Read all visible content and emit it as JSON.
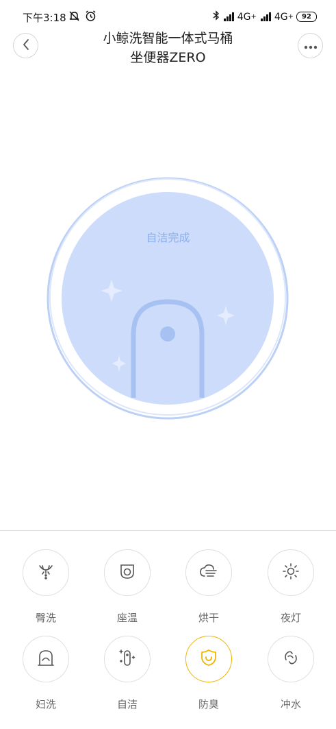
{
  "status_bar": {
    "time": "下午3:18",
    "network_1": "4G",
    "network_2": "4G",
    "battery": "92"
  },
  "header": {
    "title_line1": "小鲸洗智能一体式马桶",
    "title_line2": "坐便器ZERO"
  },
  "hero": {
    "status": "自洁完成",
    "accent": "#cddcfb"
  },
  "functions": [
    {
      "label": "臀洗",
      "icon": "hip-wash-icon",
      "active": false
    },
    {
      "label": "座温",
      "icon": "seat-temp-icon",
      "active": false
    },
    {
      "label": "烘干",
      "icon": "dry-icon",
      "active": false
    },
    {
      "label": "夜灯",
      "icon": "night-light-icon",
      "active": false
    },
    {
      "label": "妇洗",
      "icon": "feminine-wash-icon",
      "active": false
    },
    {
      "label": "自洁",
      "icon": "self-clean-icon",
      "active": false
    },
    {
      "label": "防臭",
      "icon": "deodorize-icon",
      "active": true
    },
    {
      "label": "冲水",
      "icon": "flush-icon",
      "active": false
    }
  ],
  "colors": {
    "active": "#f0b400",
    "icon": "#555555",
    "hero_fill": "#cddcfb",
    "hero_ring": "#bcd0f5"
  }
}
